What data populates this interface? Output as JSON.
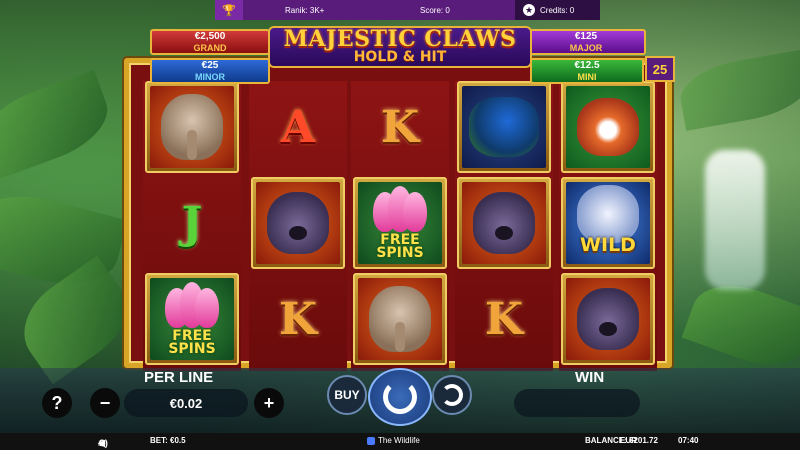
{
  "top_bar": {
    "trophy_icon": "trophy-icon",
    "rank": "Ranik: 3K+",
    "score": "Score: 0",
    "credits": "Credits: 0"
  },
  "game": {
    "title": "MAJESTIC CLAWS",
    "subtitle": "HOLD & HIT",
    "lines": "25"
  },
  "jackpots": {
    "grand": {
      "value": "€2,500",
      "name": "GRAND"
    },
    "minor": {
      "value": "€25",
      "name": "MINOR"
    },
    "major": {
      "value": "€125",
      "name": "MAJOR"
    },
    "mini": {
      "value": "€12.5",
      "name": "MINI"
    }
  },
  "reels": [
    [
      "elephant",
      "J",
      "lotus-free-spins"
    ],
    [
      "A",
      "bear",
      "K"
    ],
    [
      "K",
      "lotus-free-spins",
      "elephant"
    ],
    [
      "peacock",
      "bear",
      "K"
    ],
    [
      "red-panda",
      "tiger-wild",
      "bear"
    ]
  ],
  "symbol_text": {
    "free": "FREE",
    "spins": "SPINS",
    "wild": "WILD",
    "A": "A",
    "K": "K",
    "J": "J"
  },
  "controls": {
    "per_line_label": "PER LINE",
    "per_line_value": "€0.02",
    "win_label": "WIN",
    "win_value": "",
    "help": "?",
    "minus": "−",
    "plus": "+",
    "buy": "BUY"
  },
  "status_bar": {
    "bet": "BET: €0.5",
    "game_name": "The Wildlife",
    "balance": "BALANCE: €201.72",
    "currency": "EUR",
    "time": "07:40"
  },
  "colors": {
    "brand_purple": "#5a1c7a",
    "frame_gold": "#d8a526",
    "reel_red": "#8e1414",
    "spin_blue": "#2a5aa8"
  }
}
